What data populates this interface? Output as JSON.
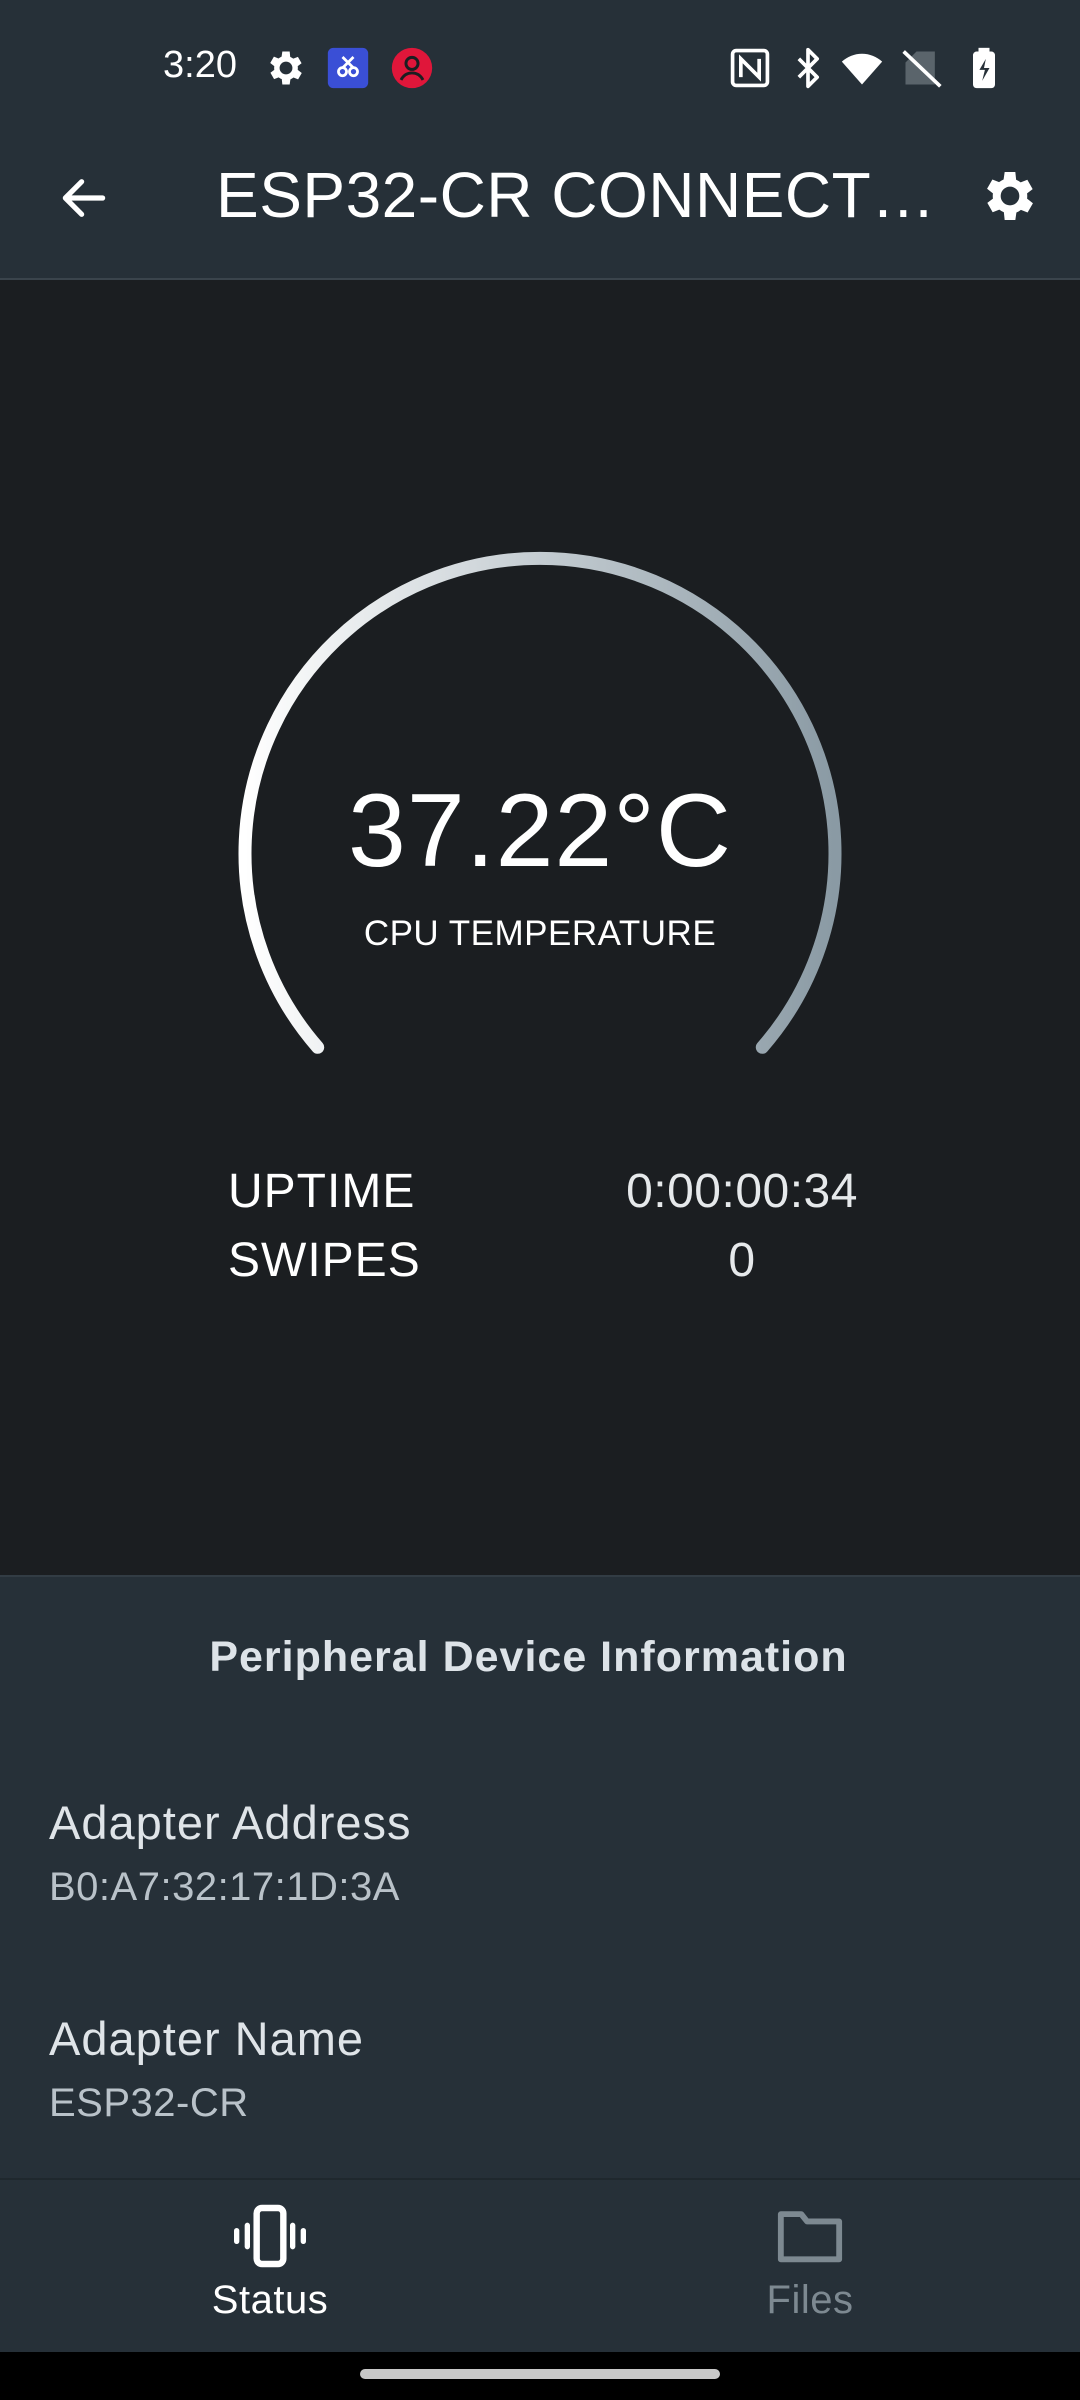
{
  "status_bar": {
    "time": "3:20",
    "left_icons": [
      "gear-icon",
      "screen-capture-app-icon",
      "user-avatar-icon"
    ],
    "right_icons": [
      "nfc-icon",
      "bluetooth-icon",
      "wifi-icon",
      "no-sim-icon",
      "battery-charging-icon"
    ]
  },
  "app_bar": {
    "title": "ESP32-CR CONNECT…",
    "back_icon": "arrow-back-icon",
    "settings_icon": "gear-icon"
  },
  "gauge": {
    "value": "37.22°C",
    "label": "CPU TEMPERATURE",
    "start_color": "#ffffff",
    "end_color": "#8a9aa4"
  },
  "stats": {
    "uptime_label": "UPTIME",
    "uptime_value": "0:00:00:34",
    "swipes_label": "SWIPES",
    "swipes_value": "0"
  },
  "peripheral_info": {
    "heading": "Peripheral Device Information",
    "items": [
      {
        "title": "Adapter Address",
        "value": "B0:A7:32:17:1D:3A"
      },
      {
        "title": "Adapter Name",
        "value": "ESP32-CR"
      }
    ]
  },
  "bottom_nav": {
    "items": [
      {
        "label": "Status",
        "icon": "vibrating-phone-icon",
        "selected": true
      },
      {
        "label": "Files",
        "icon": "folder-icon",
        "selected": false
      }
    ]
  },
  "colors": {
    "app_bar_bg": "#263038",
    "main_bg": "#1b1e21",
    "panel_bg": "#263038",
    "inactive_nav": "#7d8991"
  }
}
